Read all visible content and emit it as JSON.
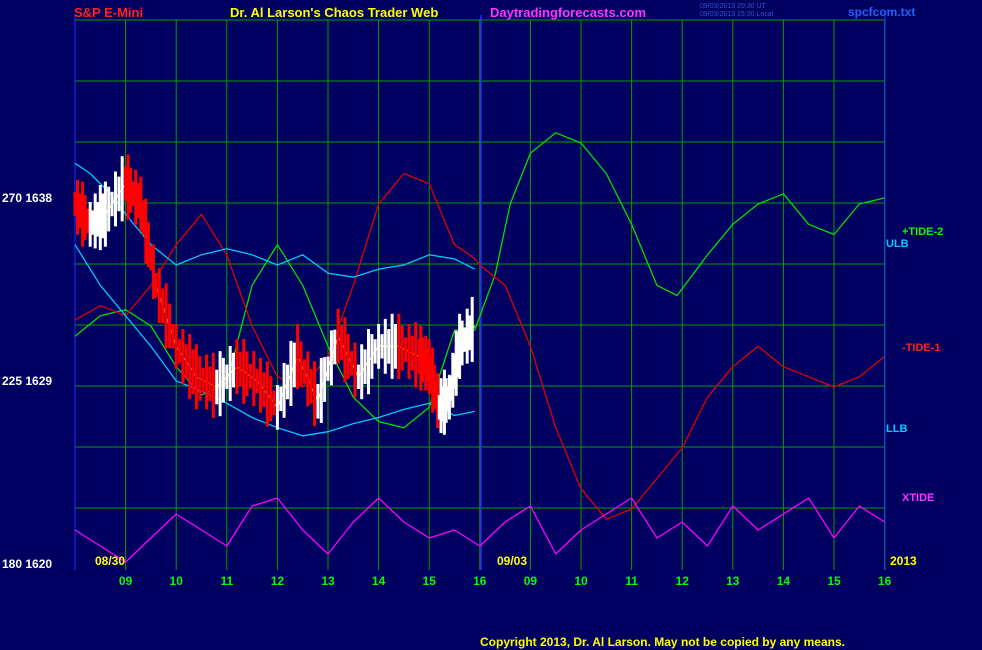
{
  "header": {
    "title_left": "S&P E-Mini",
    "title_center": "Dr. Al Larson's Chaos Trader Web",
    "site": "Daytradingforecasts.com",
    "timestamp_1": "09/03/2013 20:30 UT",
    "timestamp_2": "09/03/2013 15:30 Local",
    "file": "spcfcom.txt"
  },
  "axis": {
    "y_labels": [
      {
        "tide": "270",
        "price": "1638"
      },
      {
        "tide": "225",
        "price": "1629"
      },
      {
        "tide": "180",
        "price": "1620"
      }
    ],
    "x_ticks": [
      "09",
      "10",
      "11",
      "12",
      "13",
      "14",
      "15",
      "16",
      "09",
      "10",
      "11",
      "12",
      "13",
      "14",
      "15",
      "16"
    ],
    "date_left": "08/30",
    "date_mid": "09/03",
    "year": "2013"
  },
  "labels": {
    "tide2": "+TIDE-2",
    "ulb": "ULB",
    "tide1": "-TIDE-1",
    "llb": "LLB",
    "xtide": "XTIDE"
  },
  "copyright": "Copyright 2013, Dr. Al Larson. May not be copied by any means.",
  "colors": {
    "background": "#000060",
    "grid": "#00a000",
    "frame": "#2030ff",
    "price": "#ffffff",
    "price_down": "#ff0000",
    "tide2": "#00e000",
    "tide1": "#e00000",
    "bands": "#00c8ff",
    "xtide": "#ff00ff",
    "average": "#ffff00"
  },
  "chart_data": {
    "type": "line",
    "title": "S&P E-Mini",
    "x_ticks": [
      "09",
      "10",
      "11",
      "12",
      "13",
      "14",
      "15",
      "16",
      "09",
      "10",
      "11",
      "12",
      "13",
      "14",
      "15",
      "16"
    ],
    "y_ticks": [
      {
        "tide": 270,
        "price": 1638
      },
      {
        "tide": 225,
        "price": 1629
      },
      {
        "tide": 180,
        "price": 1620
      }
    ],
    "x_range": [
      0,
      16
    ],
    "price_range": [
      1620,
      1640.2
    ],
    "xtide_range": [
      0,
      1
    ],
    "grid": true,
    "series": [
      {
        "name": "+TIDE-2",
        "x": [
          0,
          0.5,
          1,
          1.5,
          2,
          2.5,
          3,
          3.5,
          4,
          4.5,
          5,
          5.5,
          6,
          6.5,
          7,
          7.5,
          7.9,
          8.3,
          8.6,
          9,
          9.5,
          10,
          10.5,
          11,
          11.5,
          11.9,
          12.5,
          13,
          13.5,
          14,
          14.5,
          15,
          15.5,
          16
        ],
        "y": [
          1631.5,
          1632.5,
          1632.8,
          1632,
          1630,
          1628.6,
          1629.2,
          1634,
          1636,
          1634,
          1631,
          1628.5,
          1627.3,
          1627,
          1628,
          1631.8,
          1631.8,
          1634.5,
          1638,
          1640.5,
          1641.5,
          1641,
          1639.5,
          1637,
          1634,
          1633.5,
          1635.5,
          1637,
          1638,
          1638.5,
          1637,
          1636.5,
          1638,
          1638.3
        ]
      },
      {
        "name": "-TIDE-1",
        "x": [
          0,
          0.5,
          1,
          1.5,
          2,
          2.5,
          3,
          3.5,
          4,
          4.5,
          5,
          5.5,
          6,
          6.5,
          7,
          7.5,
          7.8,
          7.9,
          8,
          8.5,
          9,
          9.5,
          10,
          10.5,
          11,
          11.5,
          12,
          12.5,
          13,
          13.5,
          14,
          14.5,
          15,
          15.5,
          16
        ],
        "y": [
          1632.3,
          1633,
          1632.5,
          1634,
          1636,
          1637.5,
          1635.5,
          1632,
          1629.5,
          1629,
          1630.5,
          1634,
          1638,
          1639.5,
          1639,
          1636,
          1635.5,
          1635.3,
          1635,
          1634,
          1631,
          1627,
          1624,
          1622.5,
          1623,
          1624.5,
          1626,
          1628.5,
          1630,
          1631,
          1630,
          1629.5,
          1629,
          1629.5,
          1630.5
        ]
      },
      {
        "name": "ULB",
        "x": [
          0,
          0.3,
          0.7,
          1,
          1.5,
          2,
          2.5,
          3,
          3.5,
          4,
          4.5,
          5,
          5.5,
          6,
          6.5,
          7,
          7.5,
          7.9
        ],
        "y": [
          1640,
          1639.5,
          1638.5,
          1637.5,
          1636,
          1635,
          1635.5,
          1635.8,
          1635.5,
          1635,
          1635.5,
          1634.6,
          1634.4,
          1634.8,
          1635,
          1635.5,
          1635.3,
          1634.8
        ]
      },
      {
        "name": "LLB",
        "x": [
          0,
          0.5,
          1,
          1.5,
          2,
          2.5,
          3,
          3.5,
          4,
          4.5,
          5,
          5.5,
          6,
          6.5,
          7,
          7.5,
          7.9
        ],
        "y": [
          1636,
          1634,
          1632.5,
          1631,
          1629.3,
          1628.8,
          1628.2,
          1627.5,
          1627,
          1626.6,
          1626.8,
          1627.2,
          1627.5,
          1627.9,
          1628.2,
          1627.6,
          1627.8
        ]
      },
      {
        "name": "XTIDE",
        "x": [
          0,
          0.5,
          1,
          1.5,
          2,
          2.5,
          3,
          3.5,
          4,
          4.5,
          5,
          5.5,
          6,
          6.5,
          7,
          7.5,
          8,
          8.5,
          9,
          9.5,
          10,
          10.5,
          11,
          11.5,
          12,
          12.5,
          13,
          13.5,
          14,
          14.5,
          15,
          15.5,
          16
        ],
        "y": [
          0.5,
          0.3,
          0.1,
          0.4,
          0.7,
          0.5,
          0.3,
          0.8,
          0.9,
          0.5,
          0.2,
          0.6,
          0.9,
          0.6,
          0.4,
          0.5,
          0.3,
          0.6,
          0.8,
          0.2,
          0.5,
          0.7,
          0.9,
          0.4,
          0.6,
          0.3,
          0.8,
          0.5,
          0.7,
          0.9,
          0.4,
          0.8,
          0.6
        ]
      },
      {
        "name": "price",
        "x": [
          0,
          0.3,
          0.6,
          1,
          1.3,
          1.6,
          2,
          2.4,
          2.8,
          3.2,
          3.6,
          4,
          4.4,
          4.8,
          5.2,
          5.6,
          6,
          6.4,
          6.8,
          7,
          7.2,
          7.4,
          7.6,
          7.9
        ],
        "y": [
          1638,
          1637,
          1637.5,
          1639,
          1638,
          1634,
          1631,
          1629.5,
          1629,
          1630,
          1629.3,
          1628,
          1630.5,
          1628.3,
          1631.5,
          1629.5,
          1631,
          1631,
          1630.5,
          1630,
          1628,
          1628.5,
          1631,
          1632
        ]
      }
    ]
  }
}
